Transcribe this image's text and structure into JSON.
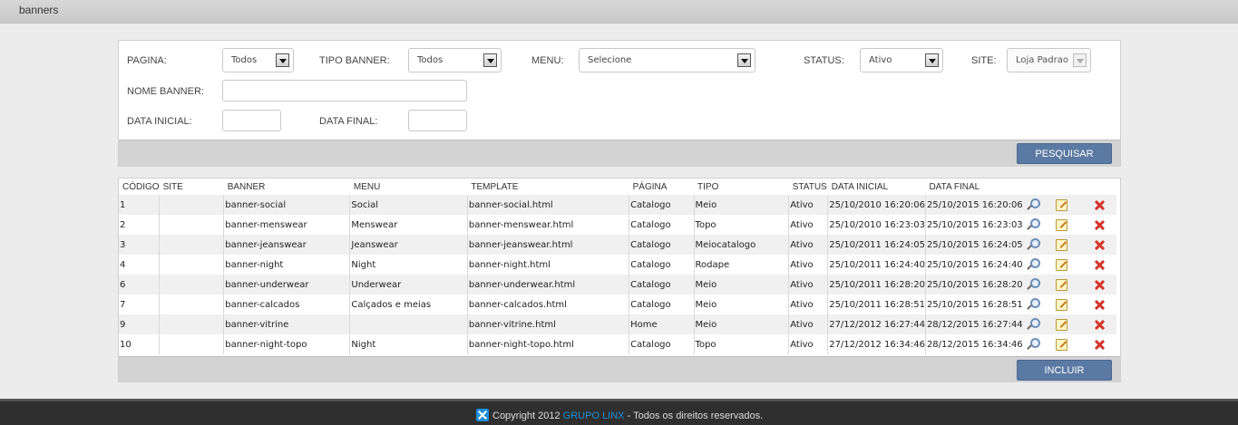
{
  "header": {
    "title": "banners"
  },
  "filters": {
    "pagina": {
      "label": "PAGINA:",
      "value": "Todos"
    },
    "tipo_banner": {
      "label": "TIPO BANNER:",
      "value": "Todos"
    },
    "menu": {
      "label": "MENU:",
      "value": "Selecione"
    },
    "status": {
      "label": "STATUS:",
      "value": "Ativo"
    },
    "site": {
      "label": "SITE:",
      "value": "Loja Padrao"
    },
    "nome_banner": {
      "label": "NOME BANNER:",
      "value": ""
    },
    "data_inicial": {
      "label": "DATA INICIAL:",
      "value": ""
    },
    "data_final": {
      "label": "DATA FINAL:",
      "value": ""
    },
    "search_button": "PESQUISAR"
  },
  "table": {
    "columns": [
      "CÓDIGO",
      "SITE",
      "BANNER",
      "MENU",
      "TEMPLATE",
      "PÁGINA",
      "TIPO",
      "STATUS",
      "DATA INICIAL",
      "DATA FINAL"
    ],
    "rows": [
      {
        "codigo": "1",
        "site": "",
        "banner": "banner-social",
        "menu": "Social",
        "template": "banner-social.html",
        "pagina": "Catalogo",
        "tipo": "Meio",
        "status": "Ativo",
        "data_inicial": "25/10/2010 16:20:06",
        "data_final": "25/10/2015 16:20:06"
      },
      {
        "codigo": "2",
        "site": "",
        "banner": "banner-menswear",
        "menu": "Menswear",
        "template": "banner-menswear.html",
        "pagina": "Catalogo",
        "tipo": "Topo",
        "status": "Ativo",
        "data_inicial": "25/10/2010 16:23:03",
        "data_final": "25/10/2015 16:23:03"
      },
      {
        "codigo": "3",
        "site": "",
        "banner": "banner-jeanswear",
        "menu": "Jeanswear",
        "template": "banner-jeanswear.html",
        "pagina": "Catalogo",
        "tipo": "Meiocatalogo",
        "status": "Ativo",
        "data_inicial": "25/10/2011 16:24:05",
        "data_final": "25/10/2015 16:24:05"
      },
      {
        "codigo": "4",
        "site": "",
        "banner": "banner-night",
        "menu": "Night",
        "template": "banner-night.html",
        "pagina": "Catalogo",
        "tipo": "Rodape",
        "status": "Ativo",
        "data_inicial": "25/10/2011 16:24:40",
        "data_final": "25/10/2015 16:24:40"
      },
      {
        "codigo": "6",
        "site": "",
        "banner": "banner-underwear",
        "menu": "Underwear",
        "template": "banner-underwear.html",
        "pagina": "Catalogo",
        "tipo": "Meio",
        "status": "Ativo",
        "data_inicial": "25/10/2011 16:28:20",
        "data_final": "25/10/2015 16:28:20"
      },
      {
        "codigo": "7",
        "site": "",
        "banner": "banner-calcados",
        "menu": "Calçados e meias",
        "template": "banner-calcados.html",
        "pagina": "Catalogo",
        "tipo": "Meio",
        "status": "Ativo",
        "data_inicial": "25/10/2011 16:28:51",
        "data_final": "25/10/2015 16:28:51"
      },
      {
        "codigo": "9",
        "site": "",
        "banner": "banner-vitrine",
        "menu": "",
        "template": "banner-vitrine.html",
        "pagina": "Home",
        "tipo": "Meio",
        "status": "Ativo",
        "data_inicial": "27/12/2012 16:27:44",
        "data_final": "28/12/2015 16:27:44"
      },
      {
        "codigo": "10",
        "site": "",
        "banner": "banner-night-topo",
        "menu": "Night",
        "template": "banner-night-topo.html",
        "pagina": "Catalogo",
        "tipo": "Topo",
        "status": "Ativo",
        "data_inicial": "27/12/2012 16:34:46",
        "data_final": "28/12/2015 16:34:46"
      }
    ],
    "include_button": "INCLUIR"
  },
  "footer": {
    "prefix": "Copyright 2012 ",
    "brand": "GRUPO LINX",
    "suffix": " - Todos os direitos reservados."
  },
  "colors": {
    "button": "#5b7aa3",
    "footer_bg": "#2f2f2f",
    "brand": "#1d8fd8"
  }
}
